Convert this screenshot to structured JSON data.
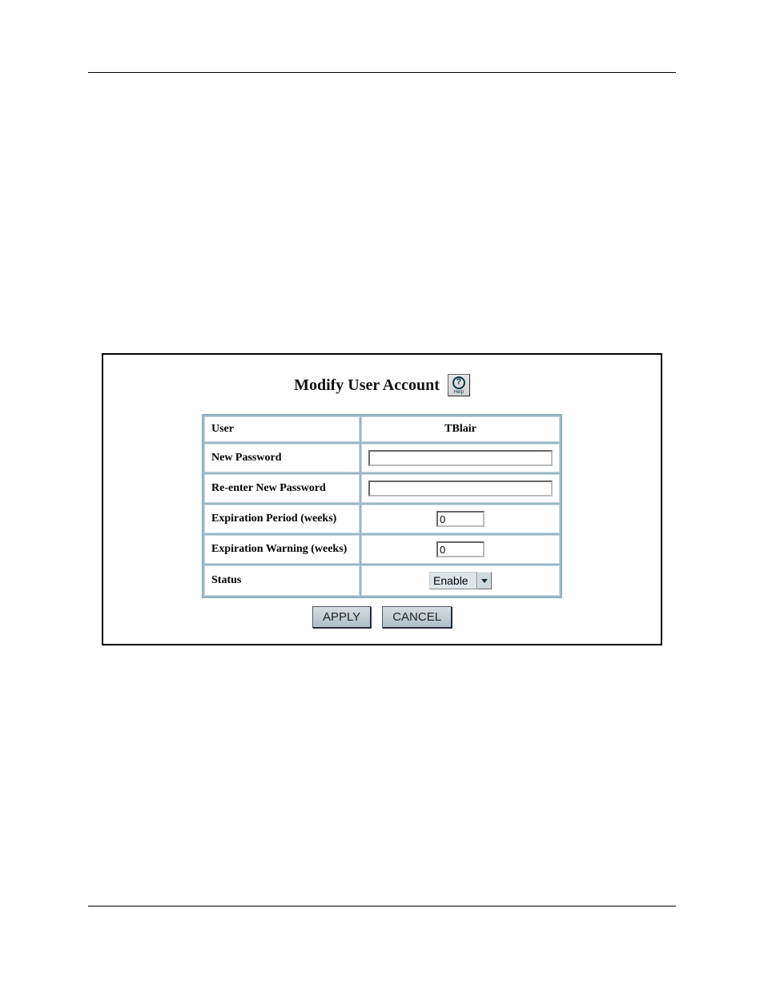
{
  "title": "Modify User Account",
  "help_label": "Help",
  "fields": {
    "user": {
      "label": "User",
      "value": "TBlair"
    },
    "new_password": {
      "label": "New Password",
      "value": ""
    },
    "reenter_password": {
      "label": "Re-enter New Password",
      "value": ""
    },
    "expiration_period": {
      "label": "Expiration Period (weeks)",
      "value": "0"
    },
    "expiration_warning": {
      "label": "Expiration Warning (weeks)",
      "value": "0"
    },
    "status": {
      "label": "Status",
      "value": "Enable"
    }
  },
  "buttons": {
    "apply": "APPLY",
    "cancel": "CANCEL"
  }
}
